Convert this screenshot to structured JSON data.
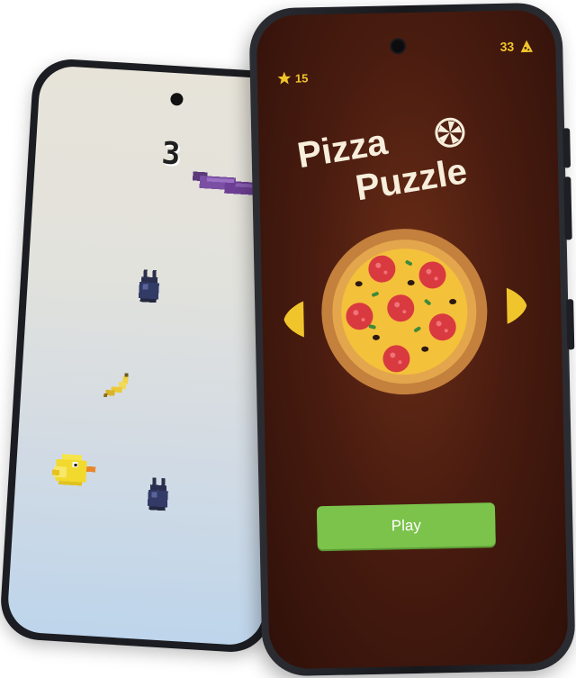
{
  "bird_game": {
    "score": "3"
  },
  "pizza_game": {
    "stars": "15",
    "pizzas": "33",
    "title_line1": "Pizza",
    "title_line2": "Puzzle",
    "play_label": "Play"
  },
  "colors": {
    "accent_yellow": "#f0c52c",
    "play_green": "#7bc34b",
    "background_brown": "#4a1c10",
    "title_cream": "#f7eedb"
  },
  "icons": {
    "star": "star-icon",
    "pizza_slice": "pizza-slice-icon",
    "arrow_left": "arrow-left-icon",
    "arrow_right": "arrow-right-icon"
  }
}
